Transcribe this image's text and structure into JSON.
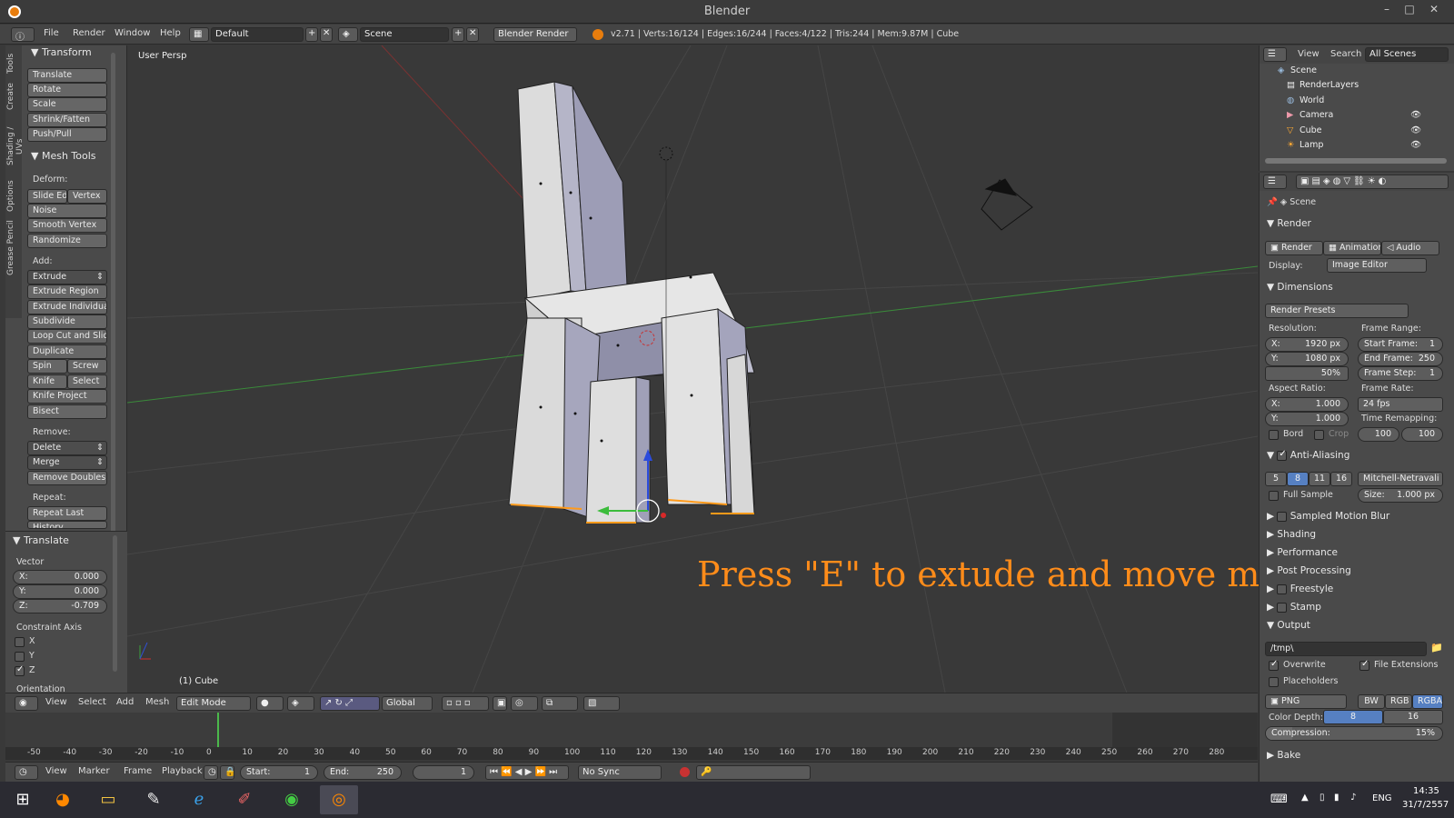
{
  "window": {
    "title": "Blender"
  },
  "infobar": {
    "menus": [
      "File",
      "Render",
      "Window",
      "Help"
    ],
    "layout": "Default",
    "scene": "Scene",
    "engine": "Blender Render",
    "stats": "v2.71 | Verts:16/124 | Edges:16/244 | Faces:4/122 | Tris:244 | Mem:9.87M | Cube"
  },
  "tool_tabs": [
    "Tools",
    "Create",
    "Shading / UVs",
    "Options",
    "Grease Pencil"
  ],
  "tools": {
    "transform_header": "Transform",
    "translate": "Translate",
    "rotate": "Rotate",
    "scale": "Scale",
    "shrink_fatten": "Shrink/Fatten",
    "push_pull": "Push/Pull",
    "mesh_tools_header": "Mesh Tools",
    "deform_label": "Deform:",
    "slide_edge": "Slide Ed",
    "vertex": "Vertex",
    "noise": "Noise",
    "smooth_vertex": "Smooth Vertex",
    "randomize": "Randomize",
    "add_label": "Add:",
    "extrude": "Extrude",
    "extrude_region": "Extrude Region",
    "extrude_individual": "Extrude Individual",
    "subdivide": "Subdivide",
    "loop_cut": "Loop Cut and Slide",
    "duplicate": "Duplicate",
    "spin": "Spin",
    "screw": "Screw",
    "knife": "Knife",
    "select": "Select",
    "knife_project": "Knife Project",
    "bisect": "Bisect",
    "remove_label": "Remove:",
    "delete": "Delete",
    "merge": "Merge",
    "remove_doubles": "Remove Doubles",
    "repeat_label": "Repeat:",
    "repeat_last": "Repeat Last",
    "history": "History..."
  },
  "operator": {
    "header": "Translate",
    "vector_label": "Vector",
    "x": "X:",
    "x_val": "0.000",
    "y": "Y:",
    "y_val": "0.000",
    "z": "Z:",
    "z_val": "-0.709",
    "constraint_label": "Constraint Axis",
    "cx": "X",
    "cy": "Y",
    "cz": "Z",
    "cx_on": false,
    "cy_on": false,
    "cz_on": true,
    "orientation_label": "Orientation"
  },
  "viewport": {
    "view_name": "User Persp",
    "object_label": "(1) Cube",
    "overlay_text": "Press \"E\" to extude and move mouse"
  },
  "vp_header": {
    "menus": [
      "View",
      "Select",
      "Add",
      "Mesh"
    ],
    "mode": "Edit Mode",
    "orientation": "Global"
  },
  "timeline": {
    "ticks": [
      "-50",
      "-40",
      "-30",
      "-20",
      "-10",
      "0",
      "10",
      "20",
      "30",
      "40",
      "50",
      "60",
      "70",
      "80",
      "90",
      "100",
      "110",
      "120",
      "130",
      "140",
      "150",
      "160",
      "170",
      "180",
      "190",
      "200",
      "210",
      "220",
      "230",
      "240",
      "250",
      "260",
      "270",
      "280"
    ],
    "current_frame": 1,
    "menus": [
      "View",
      "Marker",
      "Frame",
      "Playback"
    ],
    "start_label": "Start:",
    "start": "1",
    "end_label": "End:",
    "end": "250",
    "frame": "1",
    "sync": "No Sync"
  },
  "outliner": {
    "menus": [
      "View",
      "Search"
    ],
    "filter": "All Scenes",
    "items": [
      {
        "label": "Scene",
        "icon": "scene-icon"
      },
      {
        "label": "RenderLayers",
        "icon": "renderlayers-icon"
      },
      {
        "label": "World",
        "icon": "world-icon"
      },
      {
        "label": "Camera",
        "icon": "camera-icon"
      },
      {
        "label": "Cube",
        "icon": "mesh-icon"
      },
      {
        "label": "Lamp",
        "icon": "lamp-icon"
      }
    ]
  },
  "properties": {
    "context": "Scene",
    "render_header": "Render",
    "render_btn": "Render",
    "animation_btn": "Animation",
    "audio_btn": "Audio",
    "display_label": "Display:",
    "display_value": "Image Editor",
    "dimensions_header": "Dimensions",
    "presets": "Render Presets",
    "resolution_label": "Resolution:",
    "res_x": "X:",
    "res_x_val": "1920 px",
    "res_y": "Y:",
    "res_y_val": "1080 px",
    "res_pct": "50%",
    "frame_range_label": "Frame Range:",
    "start_frame": "Start Frame:",
    "start_frame_val": "1",
    "end_frame": "End Frame:",
    "end_frame_val": "250",
    "frame_step": "Frame Step:",
    "frame_step_val": "1",
    "aspect_label": "Aspect Ratio:",
    "asp_x": "X:",
    "asp_x_val": "1.000",
    "asp_y": "Y:",
    "asp_y_val": "1.000",
    "frame_rate_label": "Frame Rate:",
    "fps": "24 fps",
    "time_remap_label": "Time Remapping:",
    "remap_old": "100",
    "remap_new": "100",
    "bord": "Bord",
    "crop": "Crop",
    "aa_header": "Anti-Aliasing",
    "aa_samples": [
      "5",
      "8",
      "11",
      "16"
    ],
    "aa_selected": "8",
    "aa_filter": "Mitchell-Netravali",
    "full_sample": "Full Sample",
    "size_label": "Size:",
    "size_val": "1.000 px",
    "sampled_motion_blur": "Sampled Motion Blur",
    "shading": "Shading",
    "performance": "Performance",
    "post_processing": "Post Processing",
    "freestyle": "Freestyle",
    "stamp": "Stamp",
    "output_header": "Output",
    "output_path": "/tmp\\",
    "overwrite": "Overwrite",
    "file_ext": "File Extensions",
    "placeholders": "Placeholders",
    "format": "PNG",
    "bw": "BW",
    "rgb": "RGB",
    "rgba": "RGBA",
    "color_depth_label": "Color Depth:",
    "depth_8": "8",
    "depth_16": "16",
    "compression_label": "Compression:",
    "compression_val": "15%",
    "bake": "Bake"
  },
  "taskbar": {
    "lang": "ENG",
    "time": "14:35",
    "date": "31/7/2557"
  },
  "colors": {
    "accent_orange": "#ff8c1a",
    "selected_blue": "#5680c2",
    "x_axis": "#b03030",
    "y_axis": "#3a9a3a"
  }
}
